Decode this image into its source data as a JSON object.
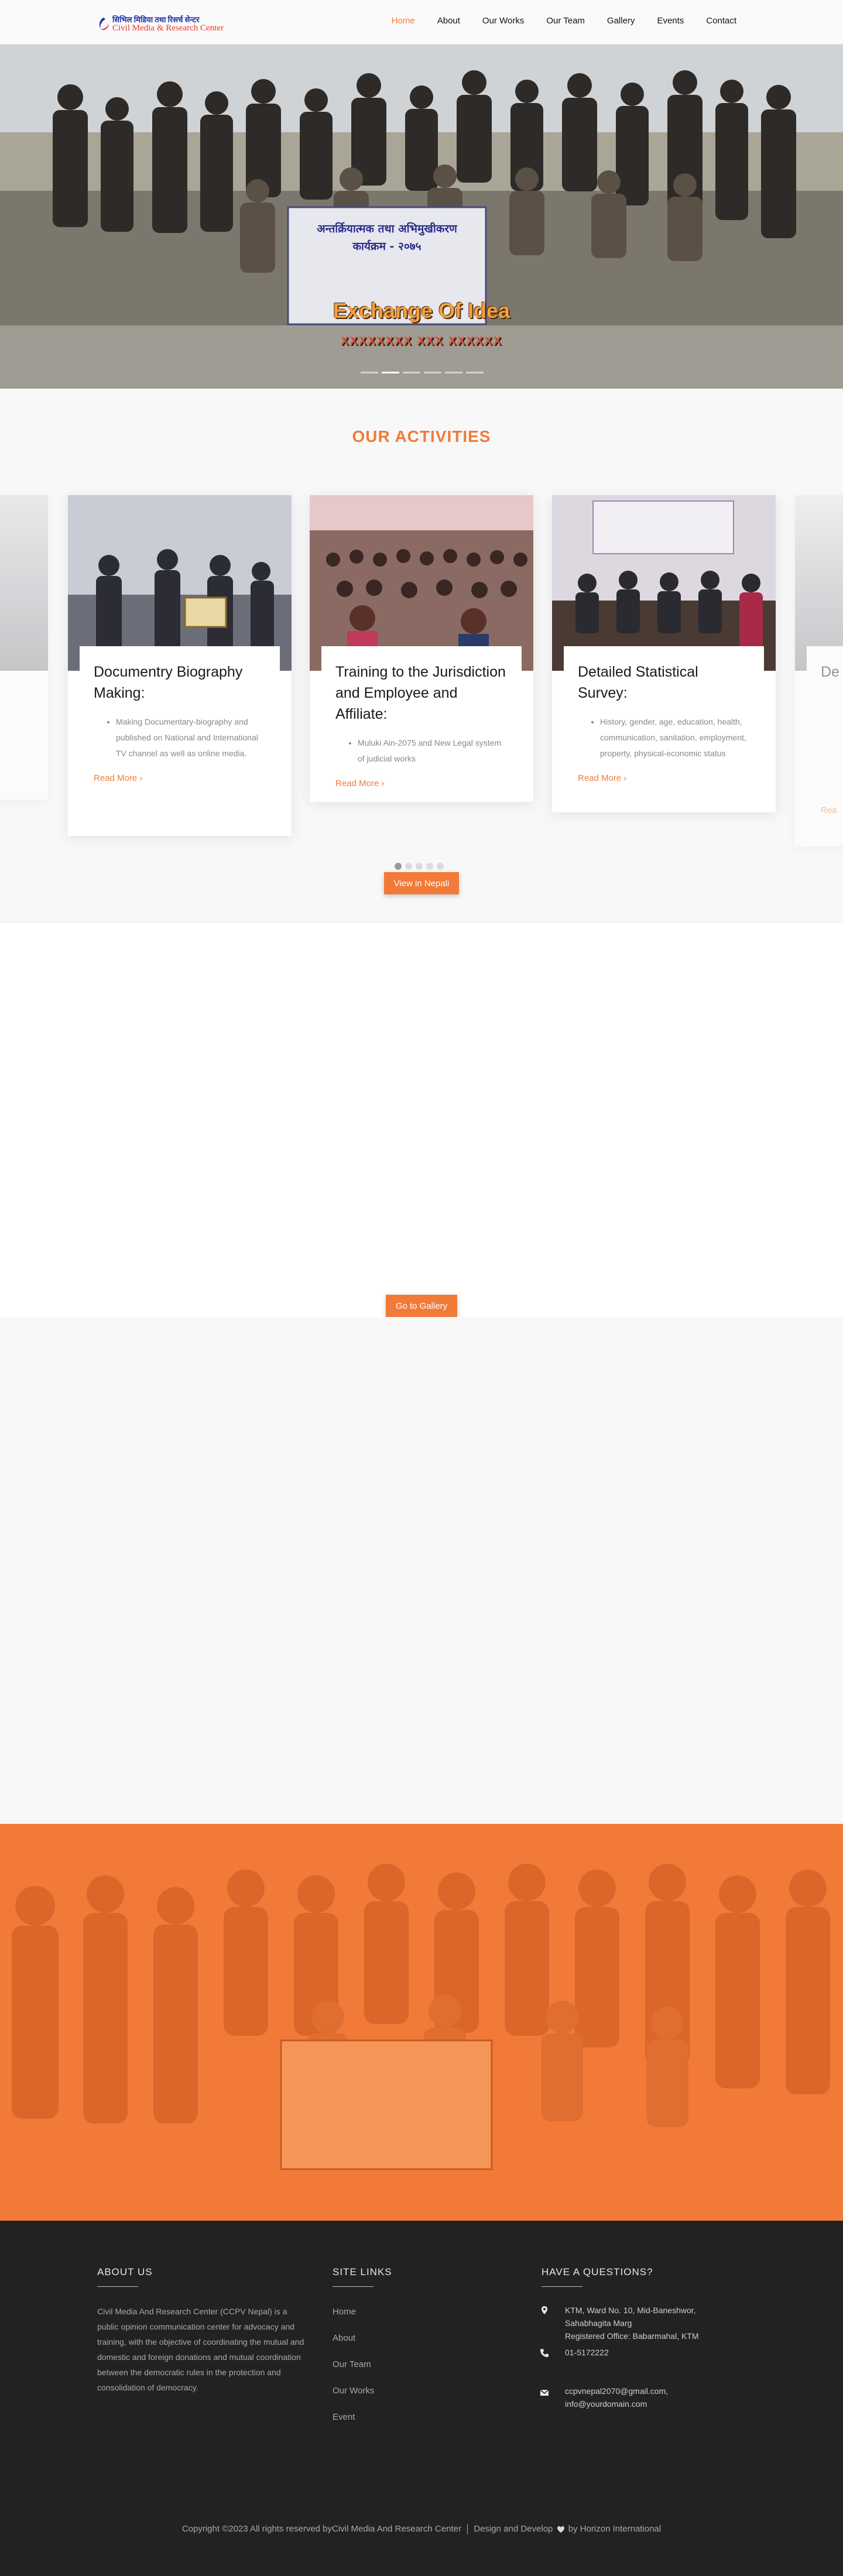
{
  "brand": {
    "logo_nepali": "सिभिल मिडिया तथा रिसर्च सेन्टर",
    "logo_english": "Civil Media & Research Center",
    "accent": "#f27a38",
    "dark": "#222222"
  },
  "nav": {
    "items": [
      {
        "label": "Home",
        "active": true
      },
      {
        "label": "About"
      },
      {
        "label": "Our Works"
      },
      {
        "label": "Our Team"
      },
      {
        "label": "Gallery"
      },
      {
        "label": "Events"
      },
      {
        "label": "Contact"
      }
    ]
  },
  "hero": {
    "banner_line1": "अन्तर्क्रियात्मक तथा अभिमुखीकरण",
    "banner_line2": "कार्यक्रम - २०७५",
    "caption": "Exchange Of Idea",
    "subcaption": "XXXXXXXX XXX XXXXXX",
    "slide_count": 6,
    "active_slide": 2
  },
  "activities": {
    "title": "OUR ACTIVITIES",
    "cards": [
      {
        "title": "Documentry Biography Making:",
        "bullet": "Making Documentary-biography and published on National and International TV channel as well as online media.",
        "more": "Read More"
      },
      {
        "title": "Training to the Jurisdiction and Employee and Affiliate:",
        "bullet": "Muluki Ain-2075 and New Legal system of judicial works",
        "more": "Read More"
      },
      {
        "title": "Detailed Statistical Survey:",
        "bullet": "History, gender, age, education, health, communication, sanitation, employment, property, physical-economic status",
        "more": "Read More"
      },
      {
        "title": "De",
        "more": "Rea"
      }
    ],
    "dot_count": 5,
    "active_dot": 1,
    "view_nepali": "View in Nepali"
  },
  "gallery": {
    "button": "Go to Gallery"
  },
  "footer": {
    "about_title": "ABOUT US",
    "about_text": "Civil Media And Research Center (CCPV Nepal) is a public opinion communication center for advocacy and training, with the objective of coordinating the mutual and domestic and foreign donations and mutual coordination between the democratic rules in the protection and consolidation of democracy.",
    "links_title": "SITE LINKS",
    "links": [
      "Home",
      "About",
      "Our Team",
      "Our Works",
      "Event"
    ],
    "contact_title": "HAVE A QUESTIONS?",
    "address_line1": "KTM, Ward No. 10, Mid-Baneshwor,",
    "address_line2": "Sahabhagita Marg",
    "address_line3": "Registered Office: Babarmahal, KTM",
    "phone": "01-5172222",
    "email1": "ccpvnepal2070@gmail.com,",
    "email2": "info@yourdomain.com",
    "copyright_prefix": "Copyright ©2023 All rights reserved by",
    "copyright_org": "Civil Media And Research Center",
    "copyright_design": "Design and Develop",
    "copyright_by": "by Horizon International"
  },
  "icons": {
    "address": "map-marker-icon",
    "phone": "phone-icon",
    "email": "envelope-icon",
    "love": "heart-icon",
    "more": "chevron-right-icon"
  }
}
